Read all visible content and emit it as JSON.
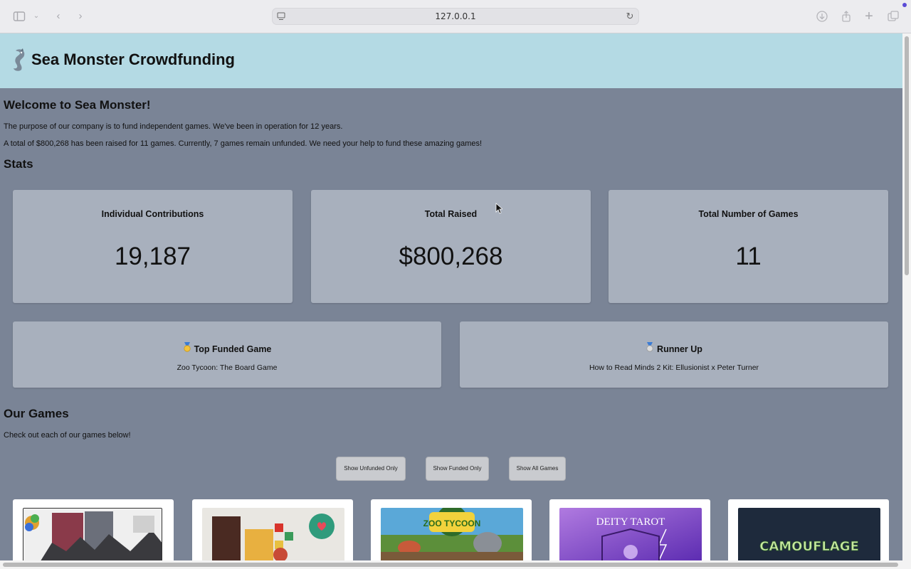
{
  "browser": {
    "url": "127.0.0.1"
  },
  "header": {
    "title": "Sea Monster Crowdfunding"
  },
  "welcome": {
    "heading": "Welcome to Sea Monster!",
    "purpose": "The purpose of our company is to fund independent games. We've been in operation for 12 years.",
    "summary": "A total of $800,268 has been raised for 11 games. Currently, 7 games remain unfunded. We need your help to fund these amazing games!"
  },
  "stats": {
    "heading": "Stats",
    "cards": [
      {
        "label": "Individual Contributions",
        "value": "19,187"
      },
      {
        "label": "Total Raised",
        "value": "$800,268"
      },
      {
        "label": "Total Number of Games",
        "value": "11"
      }
    ],
    "top_funded": {
      "label": "Top Funded Game",
      "value": "Zoo Tycoon: The Board Game",
      "icon": "gold-medal-icon"
    },
    "runner_up": {
      "label": "Runner Up",
      "value": "How to Read Minds 2 Kit: Ellusionist x Peter Turner",
      "icon": "silver-medal-icon"
    }
  },
  "games": {
    "heading": "Our Games",
    "subtitle": "Check out each of our games below!",
    "buttons": {
      "unfunded": "Show Unfunded Only",
      "funded": "Show Funded Only",
      "all": "Show All Games"
    },
    "thumb_texts": {
      "zoo": "ZOO TYCOON",
      "deity": "DEITY TAROT",
      "camo": "CAMOUFLAGE"
    }
  },
  "colors": {
    "header_bg": "#b4dae4",
    "page_bg": "#7a8496",
    "card_bg": "#a8b0bd"
  }
}
